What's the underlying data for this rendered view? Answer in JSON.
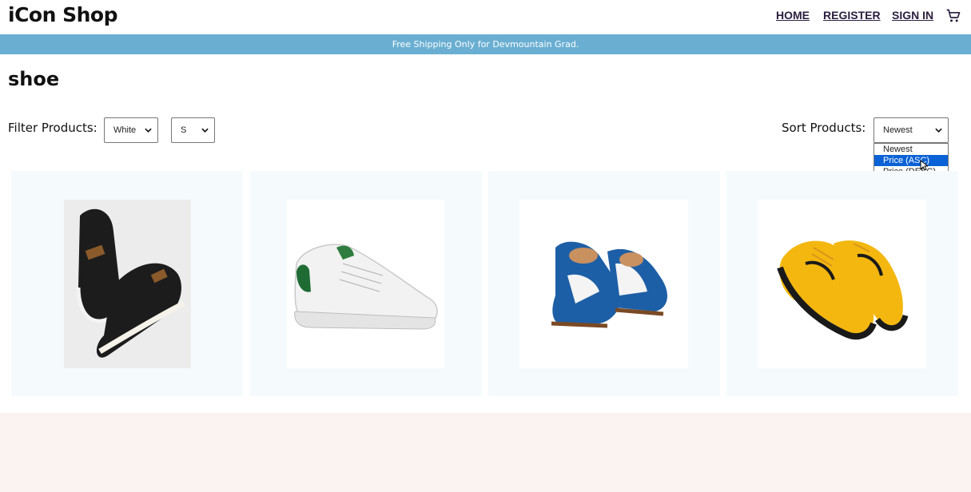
{
  "header": {
    "logo": "iCon Shop",
    "nav": {
      "home": "HOME",
      "register": "REGISTER",
      "sign_in": "SIGN IN"
    },
    "cart_icon": "shopping-cart-icon"
  },
  "announcement": "Free Shipping Only for Devmountain Grad.",
  "category_title": "shoe",
  "filters": {
    "label": "Filter Products:",
    "color": {
      "value": "White"
    },
    "size": {
      "value": "S"
    }
  },
  "sort": {
    "label": "Sort Products:",
    "value": "Newest",
    "options": [
      "Newest",
      "Price (ASC)",
      "Price (DESC)"
    ],
    "highlighted": "Price (ASC)"
  },
  "products": [
    {
      "image": "black-high-top-sneakers-image"
    },
    {
      "image": "white-green-sneaker-image"
    },
    {
      "image": "blue-white-brogue-shoes-image"
    },
    {
      "image": "yellow-black-running-shoes-image"
    }
  ],
  "colors": {
    "announcement_bg": "#6aafd2",
    "card_bg": "#f5fbfd",
    "nav_link": "#2b1f3f",
    "highlight": "#0a62d6",
    "footer_bg": "#fbf3f2"
  }
}
